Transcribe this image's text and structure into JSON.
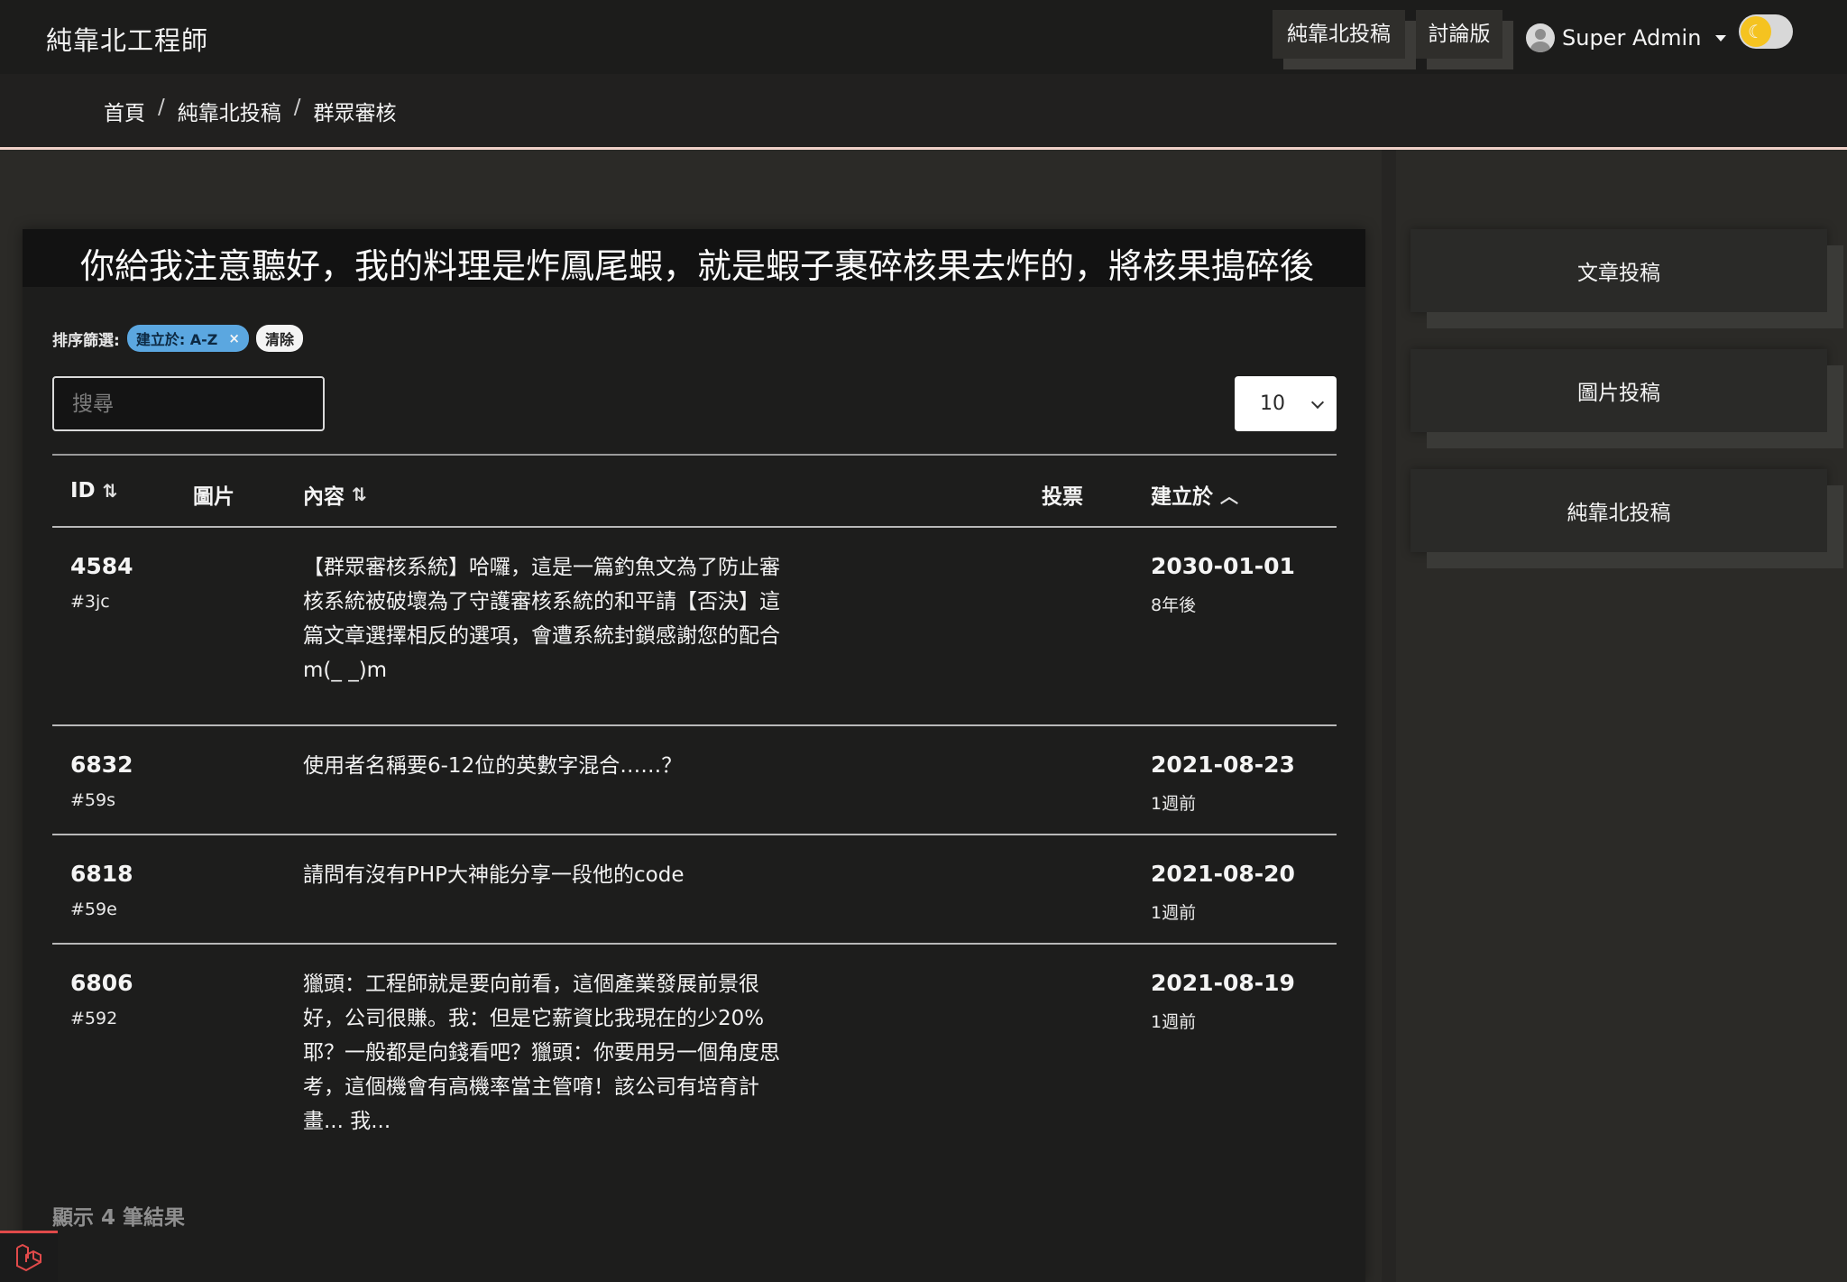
{
  "navbar": {
    "brand": "純靠北工程師",
    "links": [
      {
        "label": "純靠北投稿"
      },
      {
        "label": "討論版"
      }
    ],
    "user": {
      "name": "Super Admin"
    },
    "theme_icon": "moon-icon"
  },
  "breadcrumb": {
    "items": [
      "首頁",
      "純靠北投稿",
      "群眾審核"
    ],
    "separator": "/"
  },
  "marquee": {
    "text": "你給我注意聽好，我的料理是炸鳳尾蝦，就是蝦子裹碎核果去炸的，將核果搗碎後"
  },
  "filters": {
    "label": "排序篩選:",
    "active_chip": "建立於: A-Z",
    "clear_label": "清除"
  },
  "search": {
    "placeholder": "搜尋",
    "value": ""
  },
  "per_page": {
    "selected": "10"
  },
  "table": {
    "columns": [
      {
        "key": "id",
        "label": "ID",
        "sort_icon": "sort-both-icon"
      },
      {
        "key": "image",
        "label": "圖片"
      },
      {
        "key": "content",
        "label": "內容",
        "sort_icon": "sort-both-icon"
      },
      {
        "key": "votes",
        "label": "投票"
      },
      {
        "key": "created_at",
        "label": "建立於",
        "sort_icon": "sort-asc-icon"
      }
    ],
    "rows": [
      {
        "id": "4584",
        "hash": "#3jc",
        "content": "【群眾審核系統】哈囉，這是一篇釣魚文為了防止審核系統被破壞為了守護審核系統的和平請【否決】這篇文章選擇相反的選項，會遭系統封鎖感謝您的配合 m(_ _)m",
        "date": "2030-01-01",
        "relative": "8年後"
      },
      {
        "id": "6832",
        "hash": "#59s",
        "content": "使用者名稱要6-12位的英數字混合……？",
        "date": "2021-08-23",
        "relative": "1週前"
      },
      {
        "id": "6818",
        "hash": "#59e",
        "content": "請問有沒有PHP大神能分享一段他的code",
        "date": "2021-08-20",
        "relative": "1週前"
      },
      {
        "id": "6806",
        "hash": "#592",
        "content": "獵頭：工程師就是要向前看，這個產業發展前景很好，公司很賺。我：但是它薪資比我現在的少20%耶？一般都是向錢看吧？獵頭：你要用另一個角度思考，這個機會有高機率當主管唷！該公司有培育計畫... 我...",
        "date": "2021-08-19",
        "relative": "1週前"
      }
    ]
  },
  "result_count": "顯示 4 筆結果",
  "sidebar": {
    "buttons": [
      {
        "label": "文章投稿"
      },
      {
        "label": "圖片投稿"
      },
      {
        "label": "純靠北投稿"
      }
    ]
  },
  "footer_icon": "laravel-logo-icon"
}
